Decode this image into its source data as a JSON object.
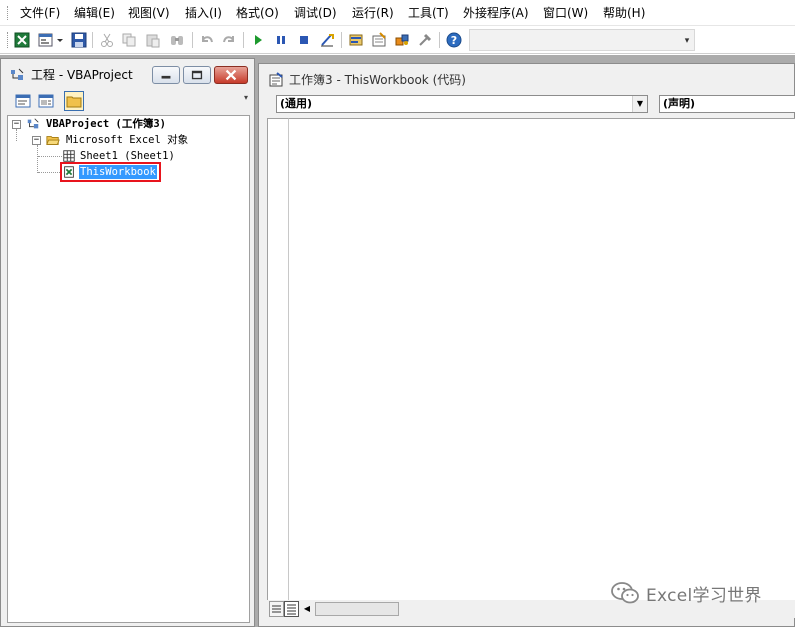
{
  "menu": {
    "items": [
      {
        "label": "文件(F)"
      },
      {
        "label": "编辑(E)"
      },
      {
        "label": "视图(V)"
      },
      {
        "label": "插入(I)"
      },
      {
        "label": "格式(O)"
      },
      {
        "label": "调试(D)"
      },
      {
        "label": "运行(R)"
      },
      {
        "label": "工具(T)"
      },
      {
        "label": "外接程序(A)"
      },
      {
        "label": "窗口(W)"
      },
      {
        "label": "帮助(H)"
      }
    ]
  },
  "toolbar": {
    "icons": [
      "excel-icon",
      "insert-userform-icon",
      "save-icon",
      "cut-icon",
      "copy-icon",
      "paste-icon",
      "find-icon",
      "undo-icon",
      "redo-icon",
      "run-icon",
      "break-icon",
      "reset-icon",
      "design-mode-icon",
      "project-explorer-icon",
      "properties-icon",
      "object-browser-icon",
      "toolbox-icon",
      "help-icon"
    ]
  },
  "project_explorer": {
    "title": "工程 - VBAProject",
    "tree": {
      "root_label": "VBAProject (工作簿3)",
      "folder_label": "Microsoft Excel 对象",
      "sheet_label": "Sheet1 (Sheet1)",
      "workbook_label": "ThisWorkbook"
    }
  },
  "code_window": {
    "title": "工作簿3 - ThisWorkbook (代码)",
    "object_combo": "(通用)",
    "procedure_combo": "(声明)"
  },
  "watermark": {
    "text": "Excel学习世界"
  },
  "colors": {
    "selection": "#3399ff",
    "highlight_border": "#e8141d",
    "workspace": "#ababab"
  }
}
